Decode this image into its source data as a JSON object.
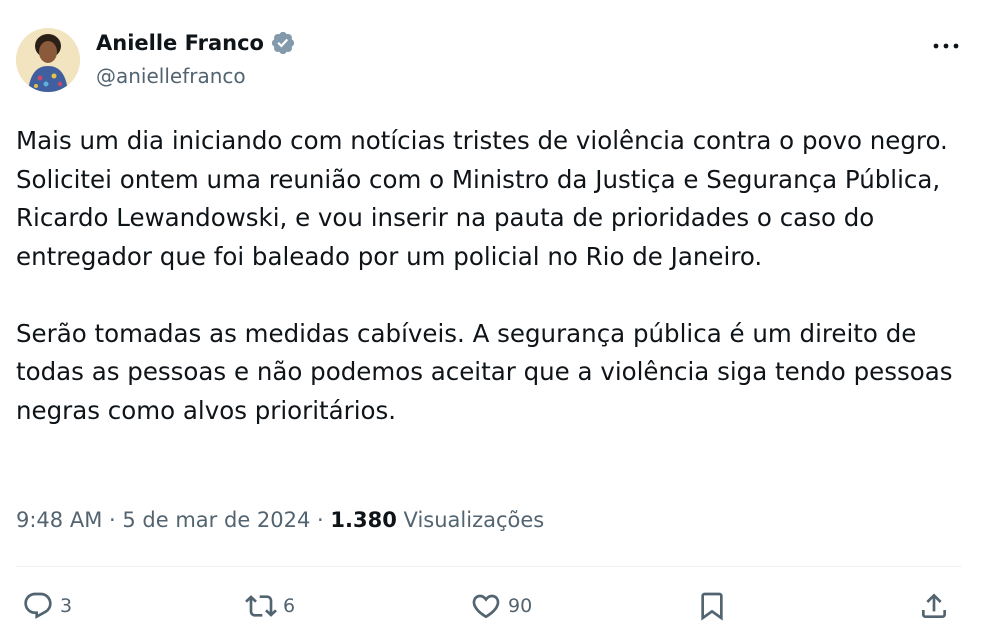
{
  "author": {
    "display_name": "Anielle Franco",
    "handle": "@aniellefranco",
    "verified_icon": "verified-badge-icon",
    "verified_color": "#829aab"
  },
  "post": {
    "paragraph_1": "Mais um dia iniciando com notícias tristes de violência contra o povo negro. Solicitei ontem uma reunião com o Ministro da Justiça e Segurança Pública, Ricardo Lewandowski, e vou inserir na pauta de prioridades o caso do entregador que foi baleado por um policial no Rio de Janeiro.",
    "paragraph_2": "Serão tomadas as medidas cabíveis. A segurança pública é um direito de todas as pessoas e não podemos aceitar que a violência siga tendo pessoas negras como alvos prioritários."
  },
  "meta": {
    "time": "9:48 AM",
    "separator": "·",
    "date": "5 de mar de 2024",
    "views_count": "1.380",
    "views_label": "Visualizações"
  },
  "actions": {
    "reply_count": "3",
    "repost_count": "6",
    "like_count": "90"
  },
  "colors": {
    "text_primary": "#0f1419",
    "text_secondary": "#536471",
    "divider": "#eff3f4"
  }
}
